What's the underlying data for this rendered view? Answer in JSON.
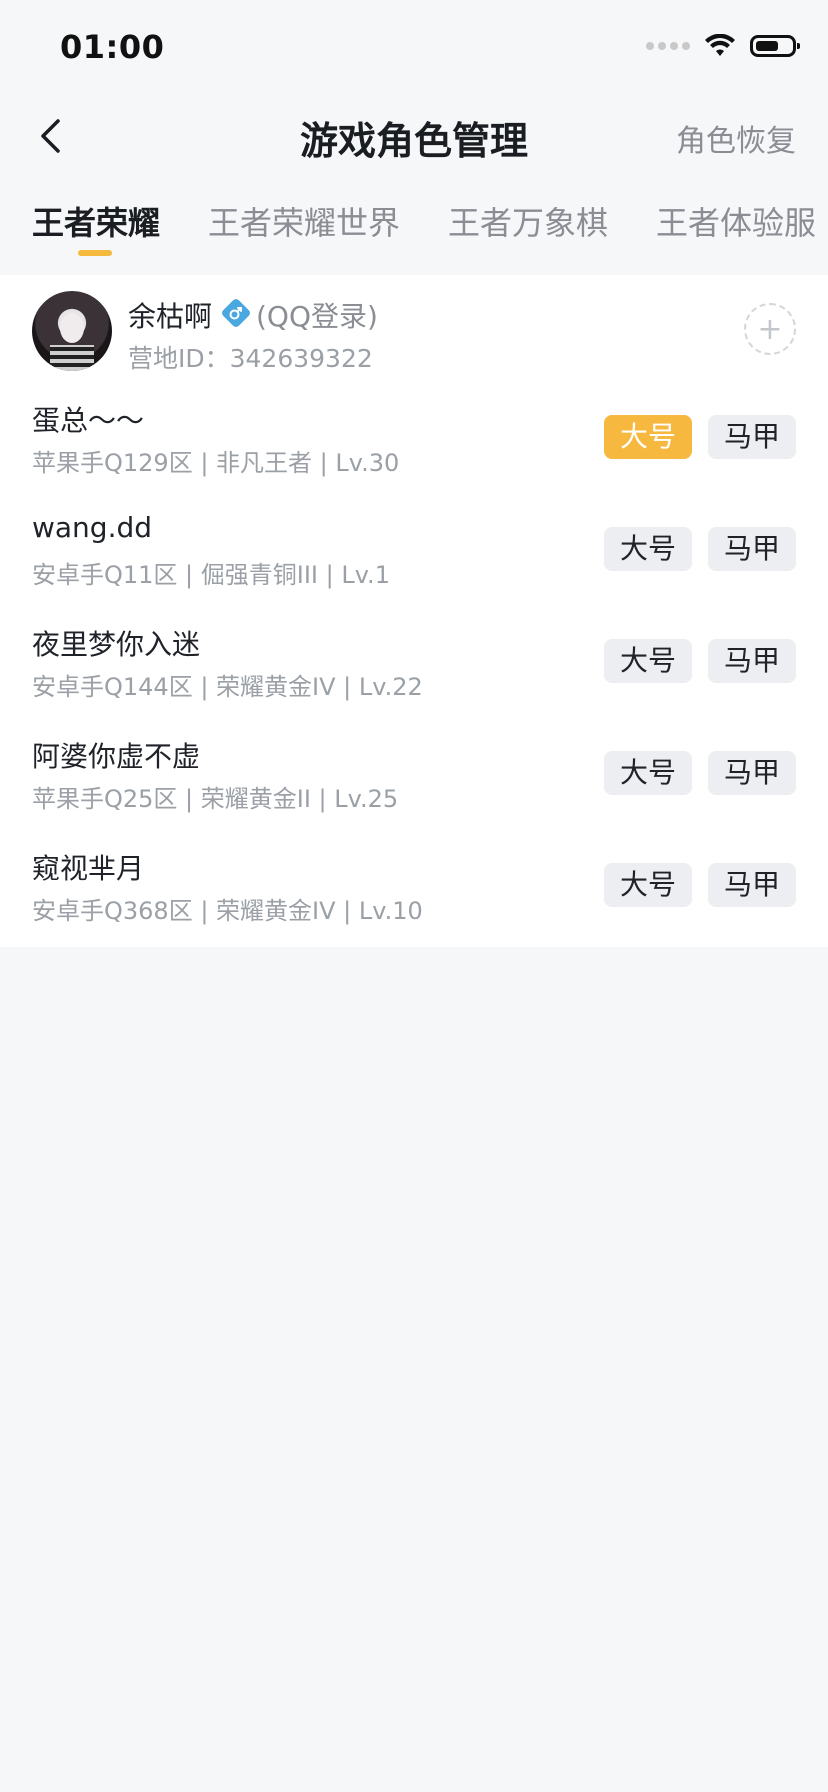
{
  "status_bar": {
    "time": "01:00"
  },
  "nav": {
    "title": "游戏角色管理",
    "right_action": "角色恢复"
  },
  "tabs": [
    {
      "label": "王者荣耀",
      "active": true
    },
    {
      "label": "王者荣耀世界",
      "active": false
    },
    {
      "label": "王者万象棋",
      "active": false
    },
    {
      "label": "王者体验服",
      "active": false
    }
  ],
  "account": {
    "name": "余枯啊",
    "gender_icon": "male-icon",
    "login_type": "(QQ登录)",
    "id_text": "营地ID：342639322"
  },
  "buttons": {
    "main_label": "大号",
    "alt_label": "马甲"
  },
  "roles": [
    {
      "name": "蛋总～～",
      "info": "苹果手Q129区 | 非凡王者 | Lv.30",
      "main_selected": true
    },
    {
      "name": "wang.dd",
      "info": "安卓手Q11区 | 倔强青铜III | Lv.1",
      "main_selected": false
    },
    {
      "name": "夜里梦你入迷",
      "info": "安卓手Q144区 | 荣耀黄金IV | Lv.22",
      "main_selected": false
    },
    {
      "name": "阿婆你虚不虚",
      "info": "苹果手Q25区 | 荣耀黄金II | Lv.25",
      "main_selected": false
    },
    {
      "name": "窥视芈月",
      "info": "安卓手Q368区 | 荣耀黄金IV | Lv.10",
      "main_selected": false
    }
  ],
  "colors": {
    "accent": "#f6b83e",
    "button_bg": "#eceef2",
    "page_bg": "#f6f7f9"
  }
}
